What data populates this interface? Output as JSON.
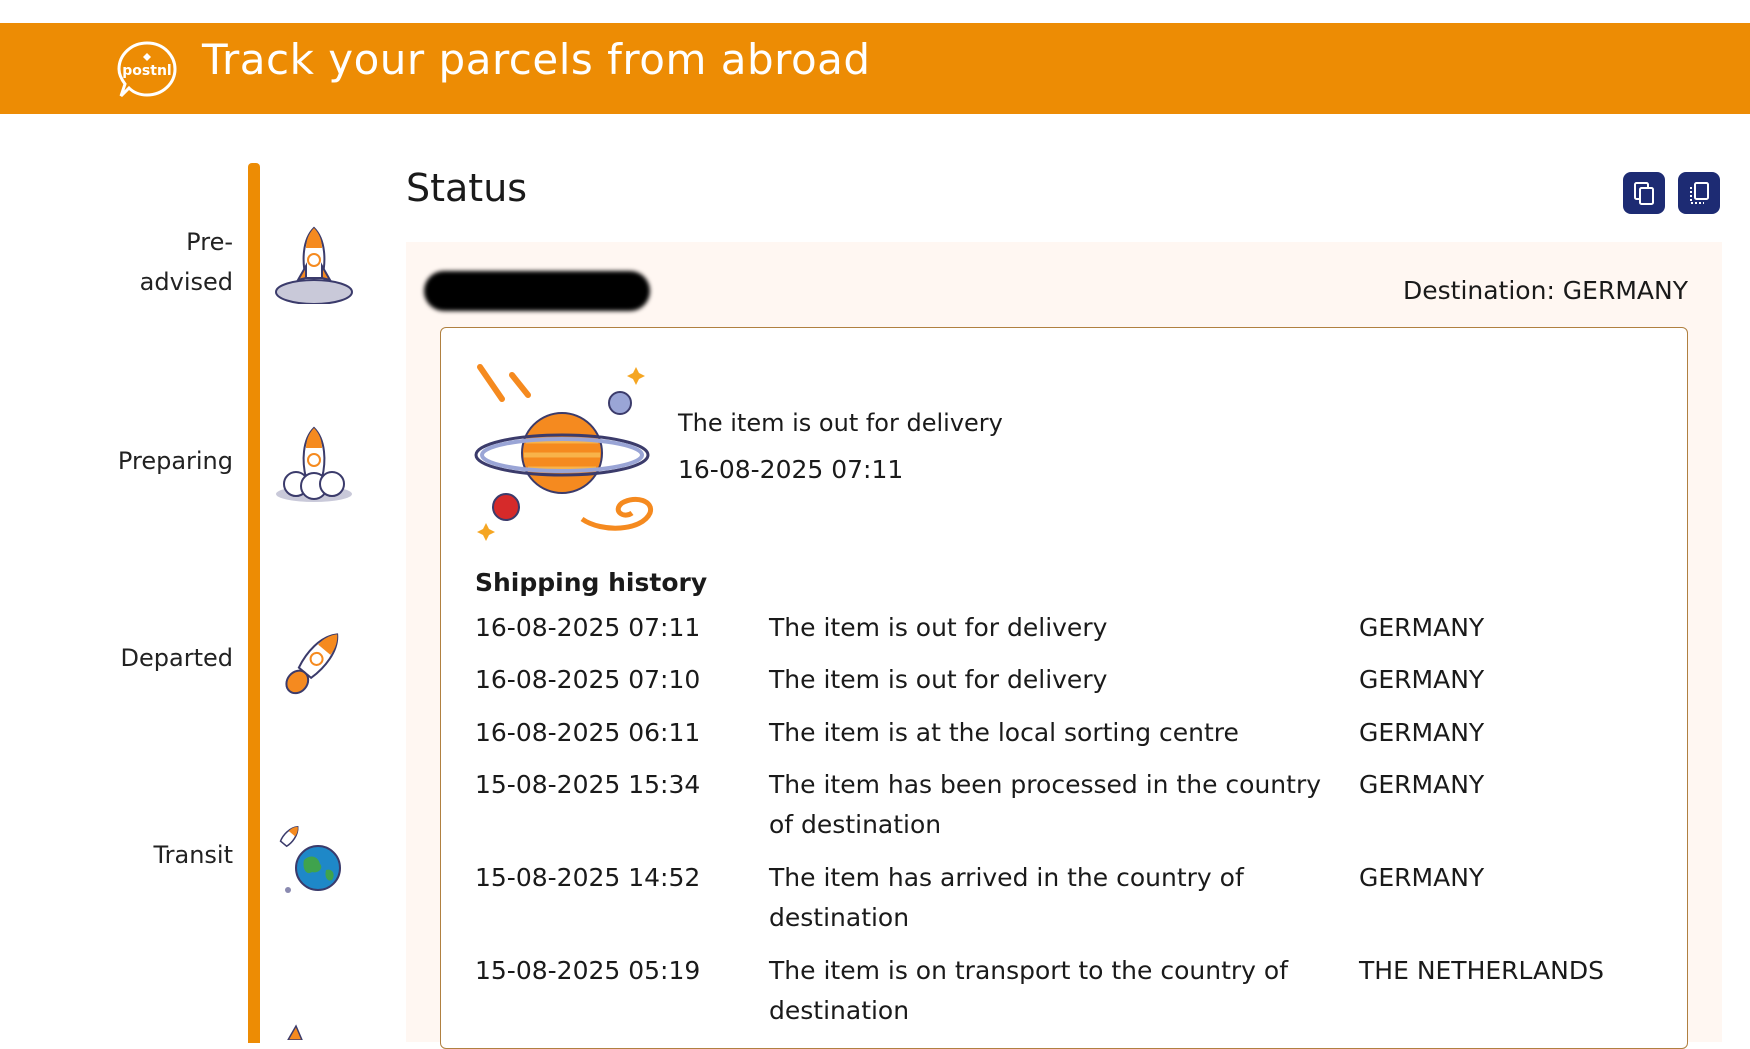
{
  "header": {
    "logo_text": "postnl",
    "title": "Track your parcels from abroad"
  },
  "timeline": {
    "steps": [
      {
        "label_line1": "Pre-",
        "label_line2": "advised"
      },
      {
        "label_line1": "Preparing"
      },
      {
        "label_line1": "Departed"
      },
      {
        "label_line1": "Transit"
      }
    ]
  },
  "status": {
    "title": "Status",
    "destination_label": "Destination: GERMANY",
    "current_status": "The item is out for delivery",
    "current_time": "16-08-2025 07:11"
  },
  "history": {
    "title": "Shipping history",
    "rows": [
      {
        "date": "16-08-2025 07:11",
        "desc": "The item is out for delivery",
        "country": "GERMANY"
      },
      {
        "date": "16-08-2025 07:10",
        "desc": "The item is out for delivery",
        "country": "GERMANY"
      },
      {
        "date": "16-08-2025 06:11",
        "desc": "The item is at the local sorting centre",
        "country": "GERMANY"
      },
      {
        "date": "15-08-2025 15:34",
        "desc": "The item has been processed in the country of destination",
        "country": "GERMANY"
      },
      {
        "date": "15-08-2025 14:52",
        "desc": "The item has arrived in the country of destination",
        "country": "GERMANY"
      },
      {
        "date": "15-08-2025 05:19",
        "desc": "The item is on transport to the country of destination",
        "country": "THE NETHERLANDS"
      }
    ]
  },
  "colors": {
    "brand_orange": "#ed8c04",
    "button_navy": "#1d2b73",
    "panel_bg": "#fff7f2"
  },
  "icons": [
    "postnl-logo-icon",
    "copy-icon",
    "share-icon",
    "rocket-moon-icon",
    "rocket-cloud-icon",
    "rocket-flying-icon",
    "earth-rocket-icon",
    "planet-icon"
  ]
}
